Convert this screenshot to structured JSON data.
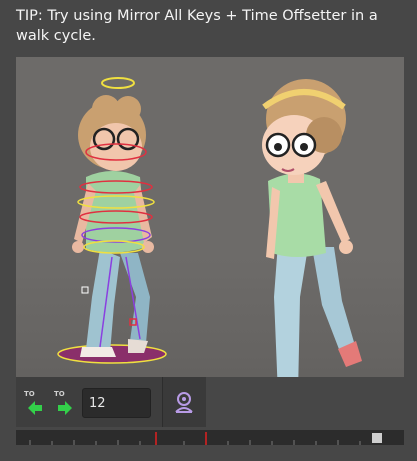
{
  "tip": {
    "text": "TIP: Try using Mirror All Keys + Time Offsetter in a walk cycle."
  },
  "controls": {
    "frame_value": "12",
    "mirror_left_badge": "TO",
    "mirror_right_badge": "TO"
  },
  "icons": {
    "mirror_left": "arrow-left-icon",
    "mirror_right": "arrow-right-icon",
    "character": "character-icon"
  },
  "colors": {
    "accent_green": "#33d04a",
    "timeline_marker": "#e02020",
    "rig_yellow": "#f0e040",
    "rig_red": "#e03040",
    "rig_purple": "#8a40e0"
  }
}
